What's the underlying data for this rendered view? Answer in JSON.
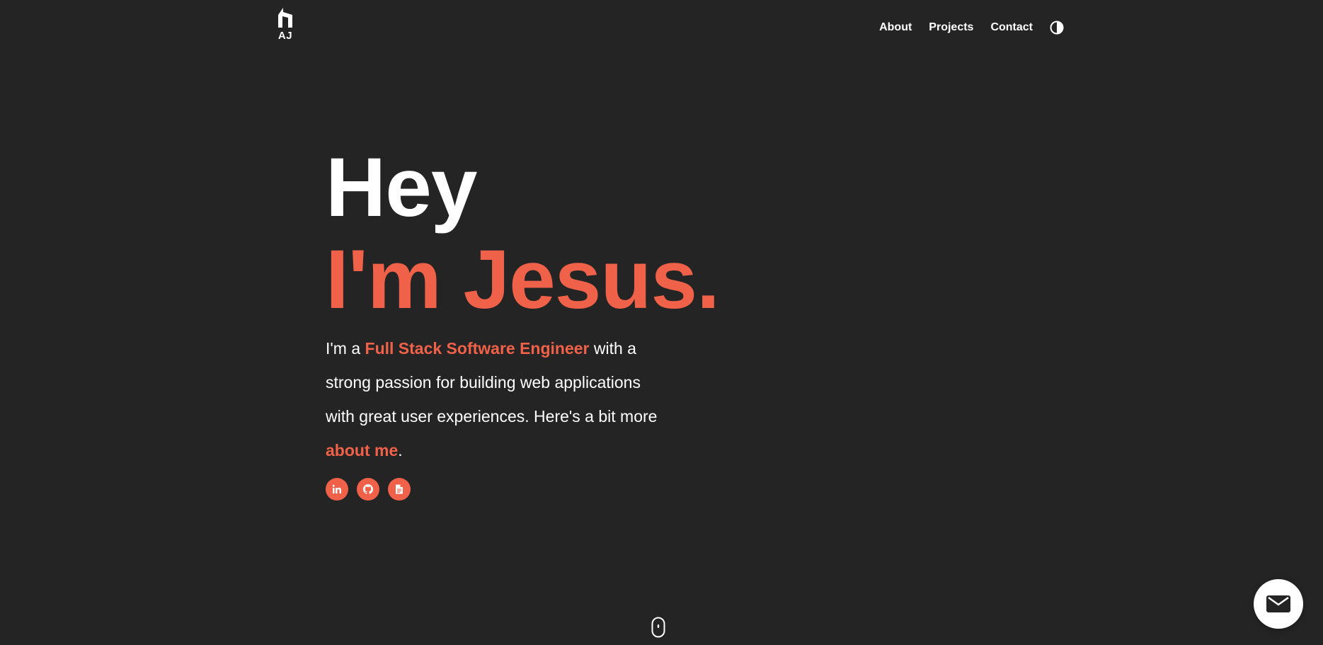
{
  "header": {
    "logo_text": "AJ",
    "logo_icon": "home-arrow-logo-icon",
    "nav": [
      {
        "label": "About"
      },
      {
        "label": "Projects"
      },
      {
        "label": "Contact"
      }
    ],
    "theme_toggle_icon": "half-circle-contrast-icon"
  },
  "hero": {
    "greeting": "Hey",
    "name": "I'm Jesus.",
    "intro_prefix": "I'm a ",
    "role": "Full Stack Software Engineer",
    "intro_middle": " with a strong passion for building web applications with great user experiences. Here's a bit more ",
    "about_link": "about me",
    "intro_suffix": "."
  },
  "socials": [
    {
      "icon": "linkedin-icon"
    },
    {
      "icon": "github-icon"
    },
    {
      "icon": "resume-document-icon"
    }
  ],
  "scroll_indicator_icon": "mouse-scroll-icon",
  "fab_icon": "envelope-icon",
  "colors": {
    "background": "#242424",
    "accent": "#f06149",
    "text": "#ffffff"
  }
}
